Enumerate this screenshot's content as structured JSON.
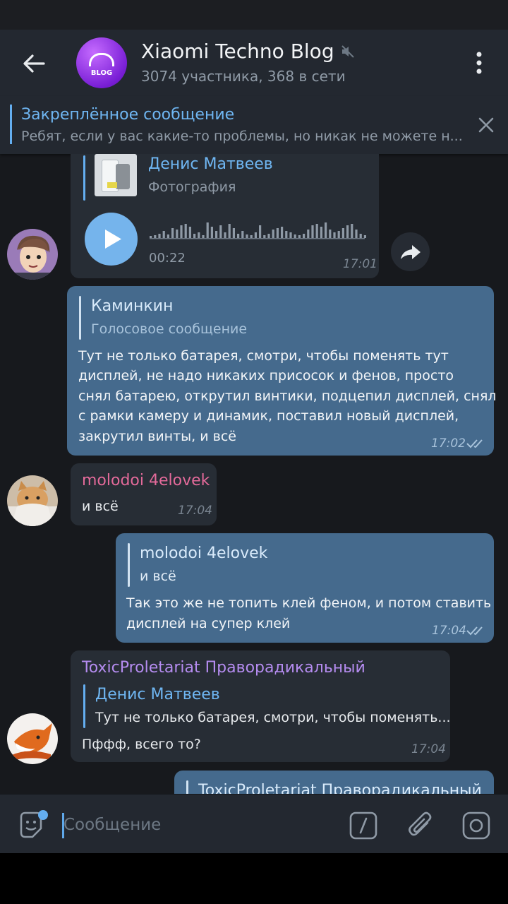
{
  "header": {
    "title": "Xiaomi Techno Blog",
    "subtitle": "3074 участника, 368 в сети",
    "avatar_text": "BLOG"
  },
  "pinned": {
    "title": "Закреплённое сообщение",
    "text": "Ребят, если у вас какие-то проблемы, но никак не можете н..."
  },
  "messages": [
    {
      "type": "incoming-voice",
      "reply_name": "Денис Матвеев",
      "reply_text": "Фотография",
      "duration": "00:22",
      "time": "17:01"
    },
    {
      "type": "outgoing",
      "reply_name": "Каминкин",
      "reply_text": "Голосовое сообщение",
      "lines": [
        "Тут не только батарея, смотри, чтобы поменять тут",
        "дисплей, не надо никаких присосок и фенов, просто",
        "снял батарею, открутил винтики, подцепил дисплей, снял",
        "с рамки камеру и динамик, поставил новый дисплей,",
        "закрутил винты, и всё"
      ],
      "time": "17:02"
    },
    {
      "type": "incoming",
      "sender": "molodoi 4elovek",
      "text": "и всё",
      "time": "17:04"
    },
    {
      "type": "outgoing",
      "reply_name": "molodoi 4elovek",
      "reply_text": "и всё",
      "lines": [
        "Так это же не топить клей феном, и потом ставить",
        "дисплей на супер клей"
      ],
      "time": "17:04"
    },
    {
      "type": "incoming",
      "sender": "ToxicProletariat Праворадикальный",
      "reply_name": "Денис Матвеев",
      "reply_text": "Тут не только батарея, смотри, чтобы поменять...",
      "text": "Пффф, всего то?",
      "time": "17:04"
    },
    {
      "type": "outgoing-partial",
      "reply_name": "ToxicProletariat Праворадикальный"
    }
  ],
  "composer": {
    "placeholder": "Сообщение"
  },
  "colors": {
    "accent": "#64aef0",
    "outgoing_bubble": "#456a8d",
    "incoming_bubble": "#272d35",
    "sender_pink": "#e36a9a",
    "sender_purple": "#b58cf0"
  }
}
